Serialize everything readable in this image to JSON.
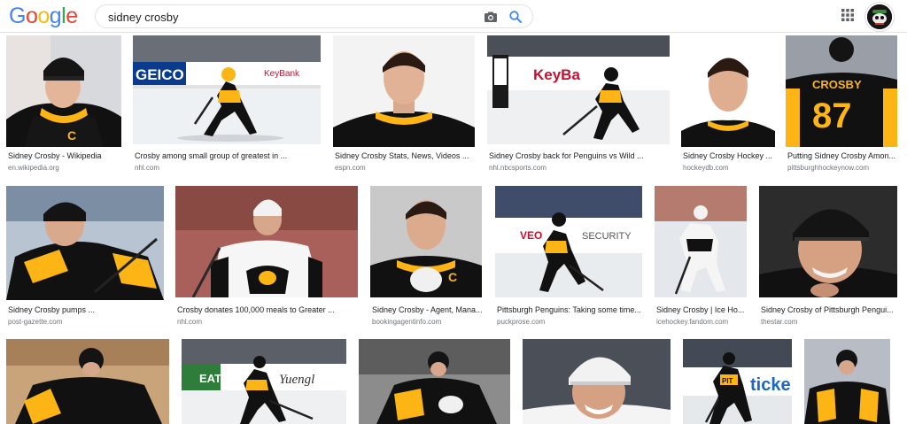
{
  "header": {
    "logo_letters": [
      "G",
      "o",
      "o",
      "g",
      "l",
      "e"
    ],
    "logo_colors": [
      "#4285F4",
      "#EA4335",
      "#FBBC05",
      "#4285F4",
      "#34A853",
      "#EA4335"
    ],
    "query": "sidney crosby"
  },
  "results": [
    {
      "caption": "Sidney Crosby - Wikipedia",
      "source": "en.wikipedia.org"
    },
    {
      "caption": "Crosby among small group of greatest in ...",
      "source": "nhl.com"
    },
    {
      "caption": "Sidney Crosby Stats, News, Videos ...",
      "source": "espn.com"
    },
    {
      "caption": "Sidney Crosby back for Penguins vs Wild ...",
      "source": "nhl.nbcsports.com"
    },
    {
      "caption": "Sidney Crosby Hockey ...",
      "source": "hockeydb.com"
    },
    {
      "caption": "Putting Sidney Crosby Amon...",
      "source": "pittsburghhockeynow.com"
    },
    {
      "caption": "Sidney Crosby pumps ...",
      "source": "post-gazette.com"
    },
    {
      "caption": "Crosby donates 100,000 meals to Greater ...",
      "source": "nhl.com"
    },
    {
      "caption": "Sidney Crosby - Agent, Mana...",
      "source": "bookingagentinfo.com"
    },
    {
      "caption": "Pittsburgh Penguins: Taking some time...",
      "source": "puckprose.com"
    },
    {
      "caption": "Sidney Crosby | Ice Ho...",
      "source": "icehockey.fandom.com"
    },
    {
      "caption": "Sidney Crosby of Pittsburgh Pengui...",
      "source": "thestar.com"
    },
    {
      "caption": "",
      "source": ""
    },
    {
      "caption": "",
      "source": ""
    },
    {
      "caption": "",
      "source": ""
    },
    {
      "caption": "",
      "source": ""
    },
    {
      "caption": "",
      "source": ""
    },
    {
      "caption": "",
      "source": ""
    }
  ],
  "image_signage": [
    "GEICO",
    "KeyBank",
    "KeyBa",
    "VEO",
    "SECURITY",
    "PIT",
    "ticke",
    "EAT",
    "Yuengl"
  ],
  "jersey_text": [
    "CROSBY",
    "87"
  ],
  "colors": {
    "accent": "#1a73e8",
    "penguins_black": "#111111",
    "penguins_gold": "#fcb514"
  }
}
